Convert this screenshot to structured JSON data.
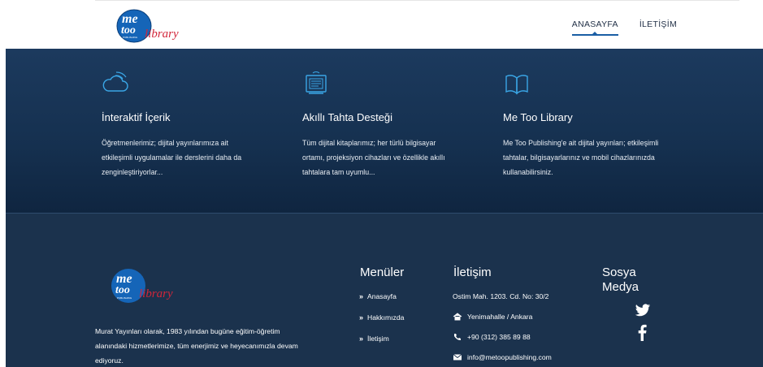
{
  "header": {
    "logo": {
      "line1": "me",
      "line2": "too",
      "badge": "PUBLISHING",
      "script": "library"
    },
    "nav": [
      {
        "label": "ANASAYFA",
        "active": true
      },
      {
        "label": "İLETİŞİM",
        "active": false
      }
    ]
  },
  "features": [
    {
      "icon": "cloud-icon",
      "title": "İnteraktif İçerik",
      "text_lines": [
        "Öğretmenlerimiz; dijital yayınlarımıza ait",
        "etkileşimli uygulamalar ile derslerini daha da",
        "zenginleştiriyorlar..."
      ]
    },
    {
      "icon": "smartboard-icon",
      "title": "Akıllı Tahta Desteği",
      "text_lines": [
        "Tüm dijital kitaplarımız; her türlü bilgisayar",
        "ortamı, projeksiyon cihazları ve özellikle akıllı",
        "tahtalara tam uyumlu..."
      ]
    },
    {
      "icon": "open-book-icon",
      "title": "Me Too Library",
      "text_lines": [
        "Me Too Publishing'e ait dijital yayınları; etkileşimli",
        "tahtalar, bilgisayarlarınız ve mobil cihazlarınızda",
        "kullanabilirsiniz."
      ]
    }
  ],
  "footer": {
    "about_lines": [
      "Murat Yayınları olarak, 1983 yılından bugüne eğitim-öğretim",
      "alanındaki hizmetlerimize, tüm enerjimiz ve heyecanımızla devam",
      "ediyoruz."
    ],
    "menu": {
      "title": "Menüler",
      "items": [
        "Anasayfa",
        "Hakkımızda",
        "İletişim"
      ]
    },
    "contact": {
      "title": "İletişim",
      "address": "Ostim Mah. 1203. Cd. No: 30/2",
      "district": "Yenimahalle / Ankara",
      "phone": "+90 (312) 385 89 88",
      "email": "info@metoopublishing.com"
    },
    "social": {
      "title_line1": "Sosya",
      "title_line2": "Medya",
      "icons": [
        "twitter-icon",
        "facebook-icon"
      ]
    }
  },
  "colors": {
    "hero_bg": "#1c3a5e",
    "footer_bg": "#1b324d",
    "accent": "#1a5ea4",
    "icon_blue": "#3aa6e6",
    "logo_red": "#d2263a"
  }
}
